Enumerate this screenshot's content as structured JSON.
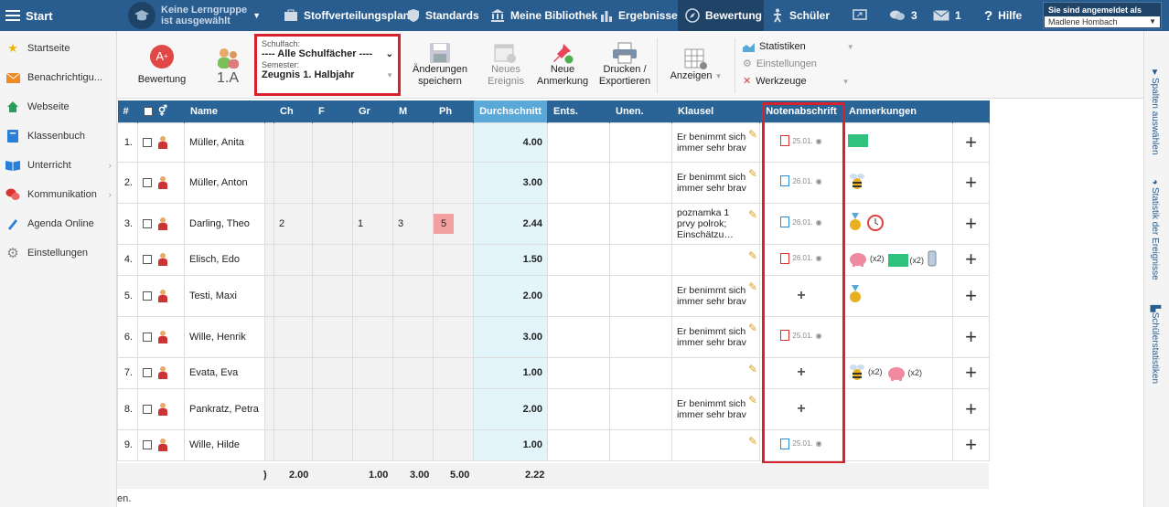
{
  "topbar": {
    "start": "Start",
    "lerngruppe_line1": "Keine Lerngruppe",
    "lerngruppe_line2": "ist ausgewählt",
    "nav": [
      "Stoffverteilungsplan",
      "Standards",
      "Meine Bibliothek",
      "Ergebnisse",
      "Bewertung",
      "Schüler"
    ],
    "msg_count": "3",
    "mail_count": "1",
    "help": "Hilfe",
    "login_label": "Sie sind angemeldet als",
    "user": "Madlene Hombach"
  },
  "sidebar": [
    "Startseite",
    "Benachrichtigu...",
    "Webseite",
    "Klassenbuch",
    "Unterricht",
    "Kommunikation",
    "Agenda Online",
    "Einstellungen"
  ],
  "toolbar": {
    "bewertung": "Bewertung",
    "klasse": "1.A",
    "schulfach_label": "Schulfach:",
    "schulfach_value": "---- Alle Schulfächer ----",
    "semester_label": "Semester:",
    "semester_value": "Zeugnis 1. Halbjahr",
    "save_1": "Änderungen",
    "save_2": "speichern",
    "neu_1": "Neues",
    "neu_2": "Ereignis",
    "anm_1": "Neue",
    "anm_2": "Anmerkung",
    "druck_1": "Drucken /",
    "druck_2": "Exportieren",
    "anzeigen": "Anzeigen",
    "statistiken": "Statistiken",
    "einstellungen": "Einstellungen",
    "werkzeuge": "Werkzeuge"
  },
  "rside": [
    "Spalten auswählen",
    "Statistik der Ereignisse",
    "Schülerstatistiken"
  ],
  "columns": [
    "#",
    "Name",
    "Ch",
    "F",
    "Gr",
    "M",
    "Ph",
    "Durchschnitt",
    "Ents.",
    "Unen.",
    "Klausel",
    "Notenabschrift",
    "Anmerkungen"
  ],
  "rows": [
    {
      "n": "1.",
      "name": "Müller, Anita",
      "ch": "",
      "gr": "",
      "m": "",
      "ph": "",
      "avg": "4.00",
      "kl": "Er benimmt sich immer sehr brav",
      "doc": "red",
      "date": "25.01.",
      "anm": "green"
    },
    {
      "n": "2.",
      "name": "Müller, Anton",
      "ch": "",
      "gr": "",
      "m": "",
      "ph": "",
      "avg": "3.00",
      "kl": "Er benimmt sich immer sehr brav",
      "doc": "blue",
      "date": "26.01.",
      "anm": "bee"
    },
    {
      "n": "3.",
      "name": "Darling, Theo",
      "ch": "2",
      "gr": "1",
      "m": "3",
      "ph": "5",
      "avg": "2.44",
      "kl": "poznamka 1 prvy polrok; Einschätzu…",
      "doc": "blue",
      "date": "26.01.",
      "anm": "medal-clock"
    },
    {
      "n": "4.",
      "name": "Elisch, Edo",
      "ch": "",
      "gr": "",
      "m": "",
      "ph": "",
      "avg": "1.50",
      "kl": "",
      "doc": "red",
      "date": "26.01.",
      "anm": "pig-green-phone"
    },
    {
      "n": "5.",
      "name": "Testi, Maxi",
      "ch": "",
      "gr": "",
      "m": "",
      "ph": "",
      "avg": "2.00",
      "kl": "Er benimmt sich immer sehr brav",
      "doc": "",
      "date": "",
      "anm": "medal"
    },
    {
      "n": "6.",
      "name": "Wille, Henrik",
      "ch": "",
      "gr": "",
      "m": "",
      "ph": "",
      "avg": "3.00",
      "kl": "Er benimmt sich immer sehr brav",
      "doc": "red",
      "date": "25.01.",
      "anm": ""
    },
    {
      "n": "7.",
      "name": "Evata, Eva",
      "ch": "",
      "gr": "",
      "m": "",
      "ph": "",
      "avg": "1.00",
      "kl": "",
      "doc": "",
      "date": "",
      "anm": "bee-pig"
    },
    {
      "n": "8.",
      "name": "Pankratz, Petra",
      "ch": "",
      "gr": "",
      "m": "",
      "ph": "",
      "avg": "2.00",
      "kl": "Er benimmt sich immer sehr brav",
      "doc": "",
      "date": "",
      "anm": ""
    },
    {
      "n": "9.",
      "name": "Wille, Hilde",
      "ch": "",
      "gr": "",
      "m": "",
      "ph": "",
      "avg": "1.00",
      "kl": "",
      "doc": "blue",
      "date": "25.01.",
      "anm": ""
    }
  ],
  "x2": "(x2)",
  "footer": {
    "ch": "2.00",
    "gr": "1.00",
    "m": "3.00",
    "ph": "5.00",
    "avg": "2.22",
    "paren": ")"
  },
  "footer_text": "en."
}
